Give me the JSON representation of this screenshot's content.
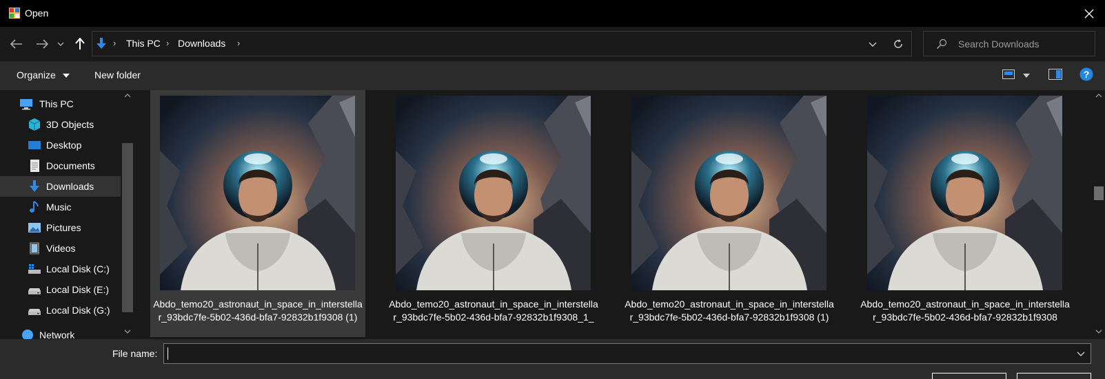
{
  "window": {
    "title": "Open"
  },
  "address": {
    "crumbs": [
      "This PC",
      "Downloads"
    ]
  },
  "search": {
    "placeholder": "Search Downloads"
  },
  "commands": {
    "organize": "Organize",
    "new_folder": "New folder"
  },
  "nav_pane": {
    "items": [
      {
        "label": "This PC",
        "icon": "pc-icon"
      },
      {
        "label": "3D Objects",
        "icon": "cube-icon"
      },
      {
        "label": "Desktop",
        "icon": "desktop-icon"
      },
      {
        "label": "Documents",
        "icon": "document-icon"
      },
      {
        "label": "Downloads",
        "icon": "download-arrow-icon",
        "selected": true
      },
      {
        "label": "Music",
        "icon": "music-note-icon"
      },
      {
        "label": "Pictures",
        "icon": "picture-icon"
      },
      {
        "label": "Videos",
        "icon": "video-icon"
      },
      {
        "label": "Local Disk (C:)",
        "icon": "windows-drive-icon"
      },
      {
        "label": "Local Disk (E:)",
        "icon": "drive-icon"
      },
      {
        "label": "Local Disk (G:)",
        "icon": "drive-icon"
      },
      {
        "label": "Network",
        "icon": "network-icon"
      }
    ]
  },
  "files": [
    {
      "name": "Abdo_temo20_astronaut_in_space_in_interstellar_93bdc7fe-5b02-436d-bfa7-92832b1f9308 (1)",
      "selected": true
    },
    {
      "name": "Abdo_temo20_astronaut_in_space_in_interstellar_93bdc7fe-5b02-436d-bfa7-92832b1f9308_1_",
      "selected": false
    },
    {
      "name": "Abdo_temo20_astronaut_in_space_in_interstellar_93bdc7fe-5b02-436d-bfa7-92832b1f9308 (1)",
      "selected": false
    },
    {
      "name": "Abdo_temo20_astronaut_in_space_in_interstellar_93bdc7fe-5b02-436d-bfa7-92832b1f9308",
      "selected": false
    }
  ],
  "file_name": {
    "label": "File name:",
    "value": ""
  },
  "colors": {
    "accent": "#2d8ae8",
    "help": "#1e88e5",
    "selection": "#3a3a3a"
  }
}
